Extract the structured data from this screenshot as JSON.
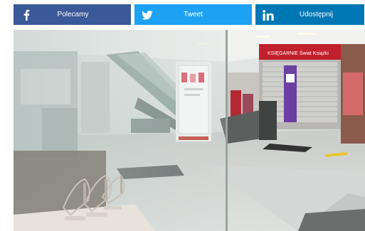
{
  "share": {
    "facebook": {
      "label": "Polecamy",
      "icon": "facebook-icon",
      "color": "#3b5998"
    },
    "twitter": {
      "label": "Tweet",
      "icon": "twitter-icon",
      "color": "#1da1f2"
    },
    "linkedin": {
      "label": "Udostępnij",
      "icon": "linkedin-icon",
      "color": "#0077b5"
    }
  },
  "photo": {
    "store_sign": "KSIĘGARNIE Świat Książki"
  }
}
